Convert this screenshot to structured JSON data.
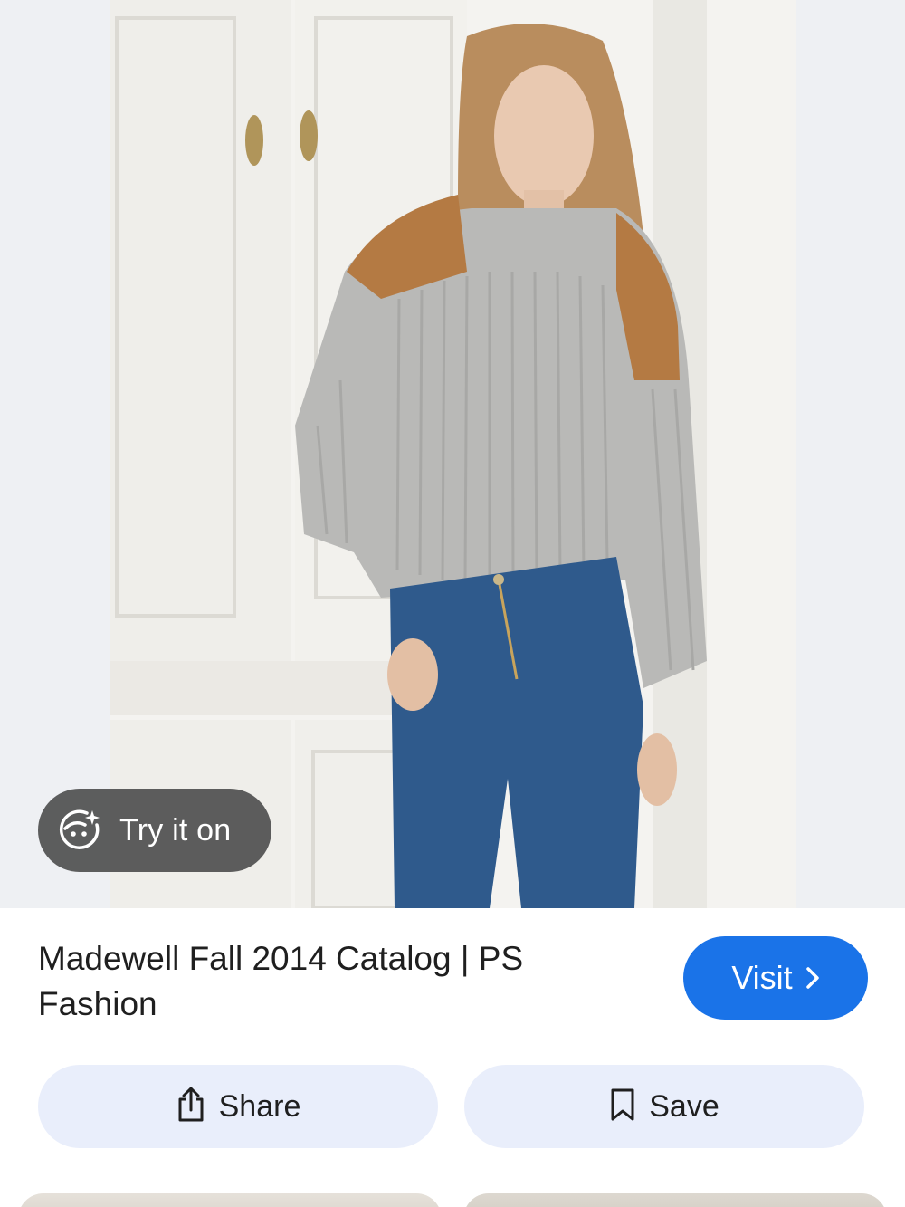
{
  "try_on": {
    "label": "Try it on",
    "icon": "face-sparkle-icon"
  },
  "pin": {
    "title": "Madewell Fall 2014 Catalog | PS Fashion"
  },
  "visit": {
    "label": "Visit",
    "icon": "chevron-right-icon",
    "color": "#1a73e8"
  },
  "actions": {
    "share": {
      "label": "Share",
      "icon": "share-icon"
    },
    "save": {
      "label": "Save",
      "icon": "bookmark-icon"
    },
    "button_color": "#e9eefb"
  }
}
